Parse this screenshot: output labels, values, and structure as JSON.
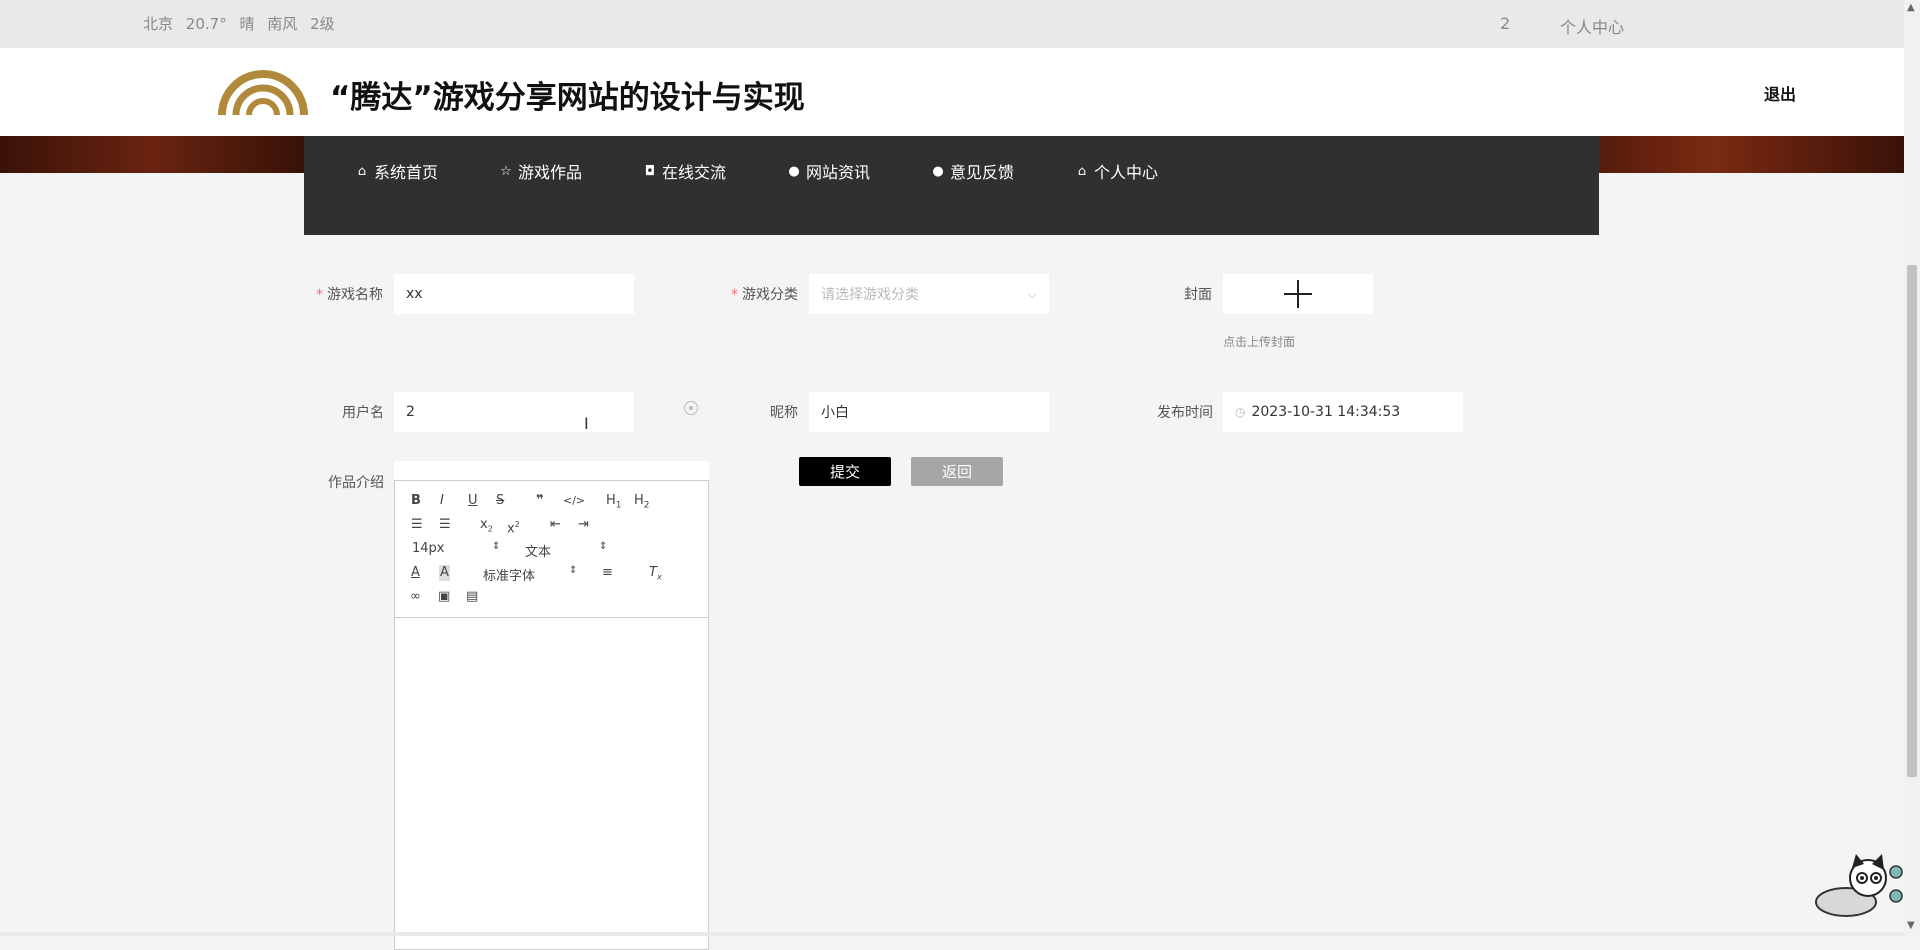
{
  "topbar": {
    "weather": {
      "city": "北京",
      "temp": "20.7°",
      "condition": "晴",
      "wind": "南风",
      "level": "2级"
    },
    "user": "2",
    "center_link": "个人中心"
  },
  "header": {
    "title": "“腾达”游戏分享网站的设计与实现",
    "logout": "退出"
  },
  "nav": {
    "items": [
      {
        "label": "系统首页",
        "icon": "home-icon"
      },
      {
        "label": "游戏作品",
        "icon": "star-icon"
      },
      {
        "label": "在线交流",
        "icon": "bag-icon"
      },
      {
        "label": "网站资讯",
        "icon": "info-icon"
      },
      {
        "label": "意见反馈",
        "icon": "question-icon"
      },
      {
        "label": "个人中心",
        "icon": "home-icon"
      }
    ]
  },
  "form": {
    "game_name_label": "游戏名称",
    "game_name_value": "xx",
    "category_label": "游戏分类",
    "category_placeholder": "请选择游戏分类",
    "cover_label": "封面",
    "cover_tip": "点击上传封面",
    "username_label": "用户名",
    "username_value": "2",
    "nickname_label": "昵称",
    "nickname_value": "小白",
    "publish_time_label": "发布时间",
    "publish_time_value": "2023-10-31 14:34:53",
    "intro_label": "作品介绍",
    "submit": "提交",
    "back": "返回"
  },
  "editor": {
    "font_size": "14px",
    "header_select": "文本",
    "font_family": "标准字体"
  },
  "colors": {
    "nav_bg": "#303030",
    "submit_bg": "#000000",
    "back_bg": "#a6a6a6",
    "required": "#f56c6c"
  }
}
